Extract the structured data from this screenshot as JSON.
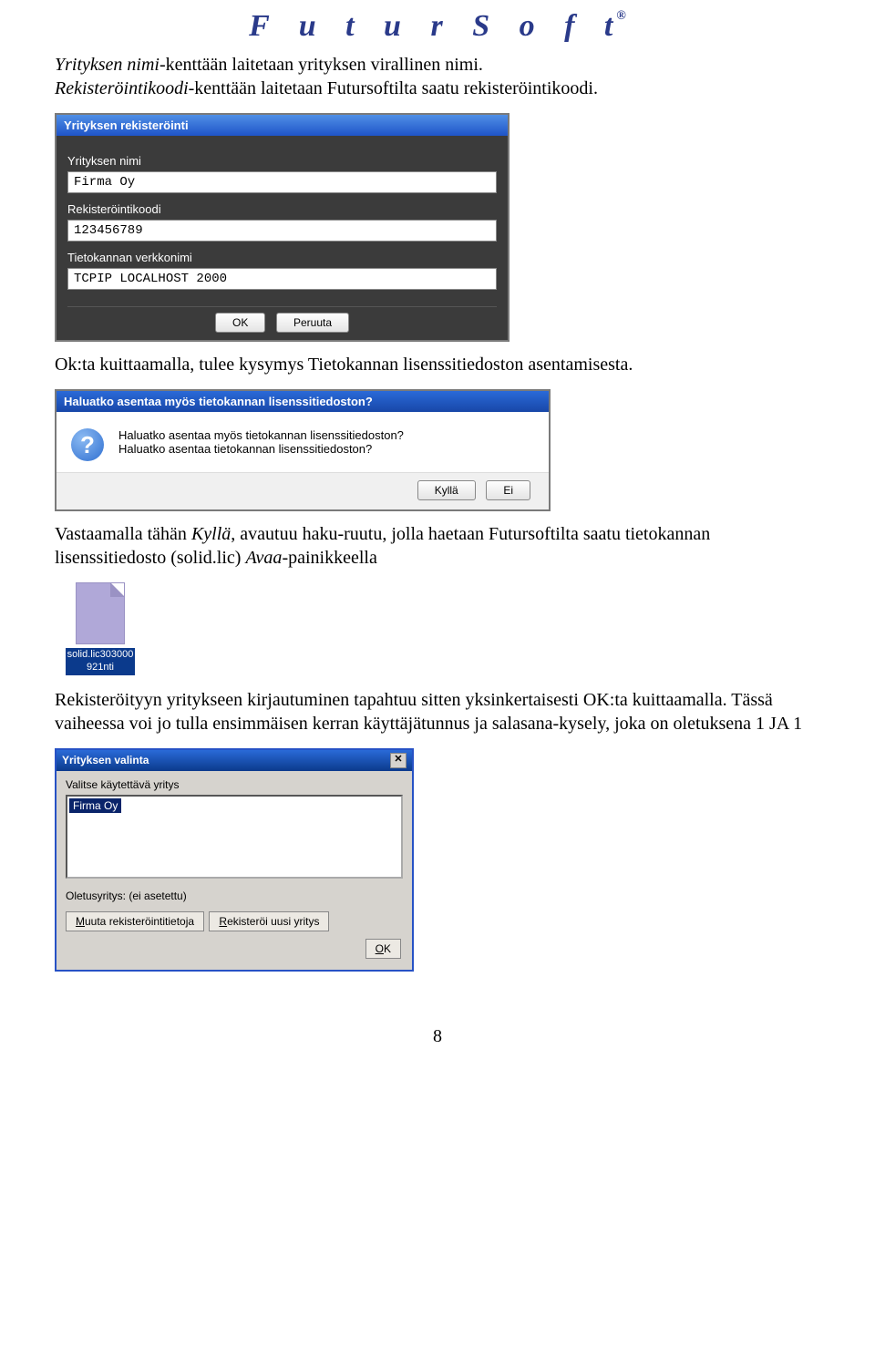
{
  "header": {
    "brand": "F u t u r S o f t",
    "reg": "®"
  },
  "para1": {
    "a_italic": "Yrityksen nimi",
    "a_plain": "-kenttään laitetaan yrityksen virallinen nimi.",
    "b_italic": "Rekisteröintikoodi",
    "b_plain": "-kenttään laitetaan Futursoftilta saatu rekisteröintikoodi."
  },
  "dialog1": {
    "title": "Yrityksen rekisteröinti",
    "label_name": "Yrityksen nimi",
    "value_name": "Firma Oy",
    "label_code": "Rekisteröintikoodi",
    "value_code": "123456789",
    "label_net": "Tietokannan verkkonimi",
    "value_net": "TCPIP LOCALHOST 2000",
    "ok": "OK",
    "cancel": "Peruuta"
  },
  "para2": "Ok:ta kuittaamalla, tulee kysymys Tietokannan lisenssitiedoston asentamisesta.",
  "dialog2": {
    "title": "Haluatko asentaa myös tietokannan lisenssitiedoston?",
    "line1": "Haluatko asentaa myös tietokannan lisenssitiedoston?",
    "line2": "Haluatko asentaa tietokannan lisenssitiedoston?",
    "yes": "Kyllä",
    "no": "Ei"
  },
  "para3": {
    "a": "Vastaamalla tähän ",
    "b_italic": "Kyllä",
    "c": ", avautuu haku-ruutu, jolla haetaan Futursoftilta saatu tietokannan lisenssitiedosto (solid.lic) ",
    "d_italic": "Avaa",
    "e": "-painikkeella"
  },
  "file": {
    "label": "solid.lic303000\n921nti"
  },
  "para4": "Rekisteröityyn yritykseen kirjautuminen tapahtuu sitten yksinkertaisesti OK:ta kuittaamalla. Tässä vaiheessa voi jo tulla ensimmäisen kerran käyttäjätunnus ja salasana-kysely, joka on oletuksena 1 JA 1",
  "dialog3": {
    "title": "Yrityksen valinta",
    "label": "Valitse käytettävä yritys",
    "item": "Firma Oy",
    "default_line": "Oletusyritys: (ei asetettu)",
    "btn_mod_pre": "M",
    "btn_mod_rest": "uuta rekisteröintitietoja",
    "btn_reg_pre": "R",
    "btn_reg_rest": "ekisteröi uusi yritys",
    "ok_pre": "O",
    "ok_rest": "K"
  },
  "page_number": "8"
}
